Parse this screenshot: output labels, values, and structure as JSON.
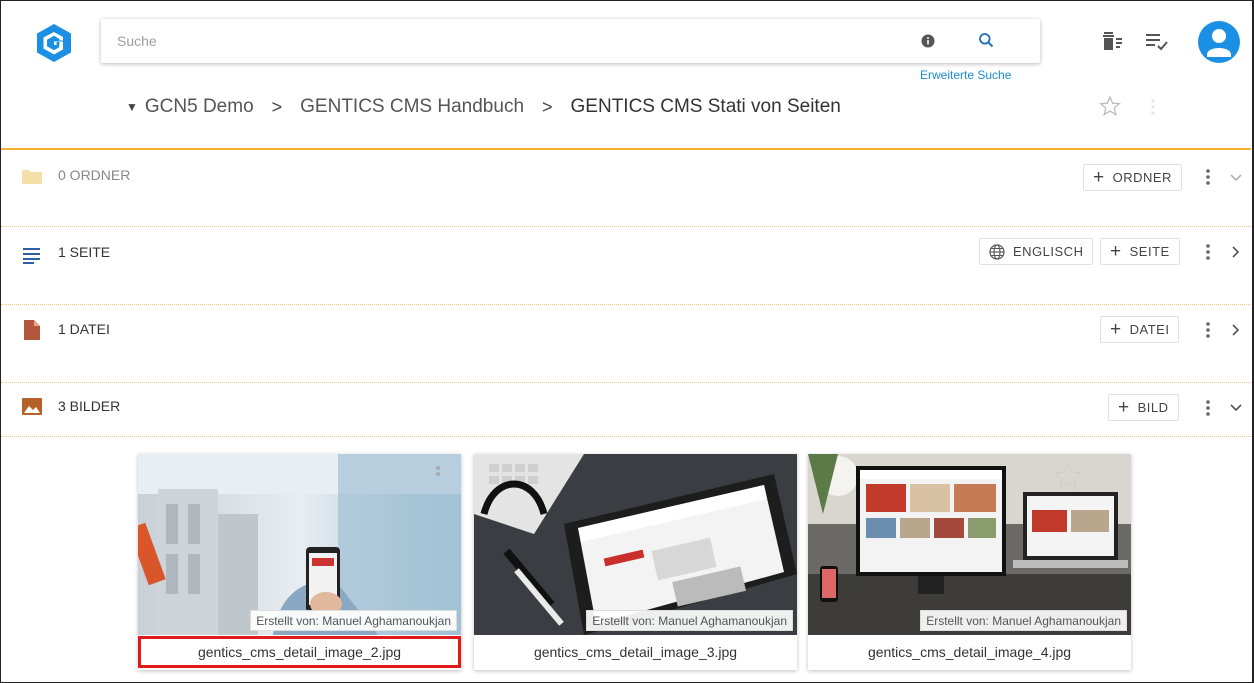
{
  "header": {
    "search_placeholder": "Suche",
    "advanced_search": "Erweiterte Suche"
  },
  "breadcrumb": {
    "items": [
      "GCN5 Demo",
      "GENTICS CMS Handbuch",
      "GENTICS CMS Stati von Seiten"
    ]
  },
  "sections": {
    "folders": {
      "label": "0 ORDNER",
      "button": "ORDNER"
    },
    "pages": {
      "label": "1 SEITE",
      "language": "ENGLISCH",
      "button": "SEITE"
    },
    "files": {
      "label": "1 DATEI",
      "button": "DATEI"
    },
    "images": {
      "label": "3 BILDER",
      "button": "BILD"
    }
  },
  "images": [
    {
      "author": "Erstellt von: Manuel Aghamanoukjan",
      "filename": "gentics_cms_detail_image_2.jpg"
    },
    {
      "author": "Erstellt von: Manuel Aghamanoukjan",
      "filename": "gentics_cms_detail_image_3.jpg"
    },
    {
      "author": "Erstellt von: Manuel Aghamanoukjan",
      "filename": "gentics_cms_detail_image_4.jpg"
    }
  ],
  "colors": {
    "accent": "#f2b230",
    "brand_blue": "#1a8fe3",
    "link": "#1c8ad6",
    "selection": "#e0191b"
  }
}
